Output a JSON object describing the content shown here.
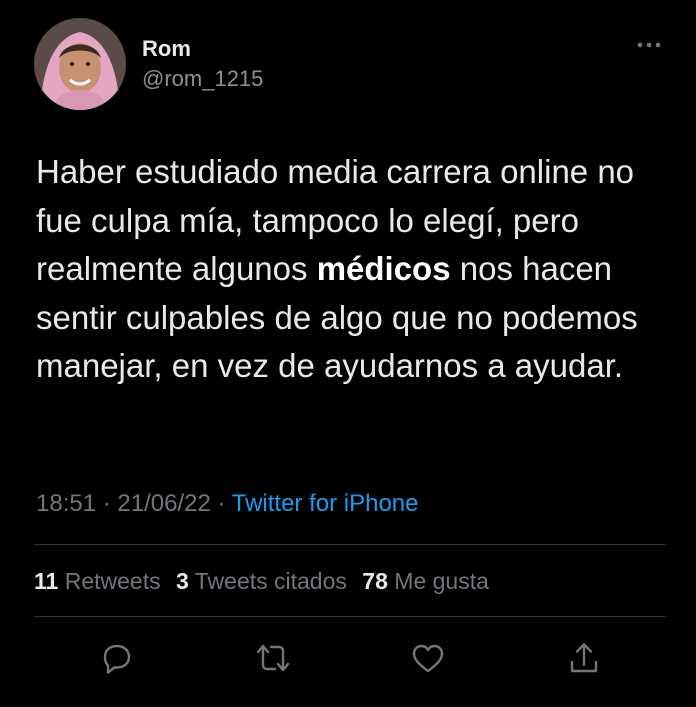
{
  "user": {
    "display_name": "Rom",
    "handle": "@rom_1215"
  },
  "tweet": {
    "text_before": "Haber estudiado media carrera online no fue culpa mía, tampoco lo elegí, pero realmente algunos ",
    "text_bold": "médicos",
    "text_after": " nos hacen sentir culpables de algo que no podemos manejar, en vez de ayudarnos a ayudar.",
    "time": "18:51",
    "date": "21/06/22",
    "separator": "·",
    "source": "Twitter for iPhone"
  },
  "stats": {
    "retweets_count": "11",
    "retweets_label": "Retweets",
    "quotes_count": "3",
    "quotes_label": "Tweets citados",
    "likes_count": "78",
    "likes_label": "Me gusta"
  },
  "icons": {
    "more": "more-horizontal-icon",
    "reply": "reply-icon",
    "retweet": "retweet-icon",
    "like": "heart-icon",
    "share": "share-icon"
  },
  "colors": {
    "background": "#000000",
    "text": "#e7e9ea",
    "muted": "#71767b",
    "link": "#1d9bf0",
    "divider": "#2f3336"
  }
}
